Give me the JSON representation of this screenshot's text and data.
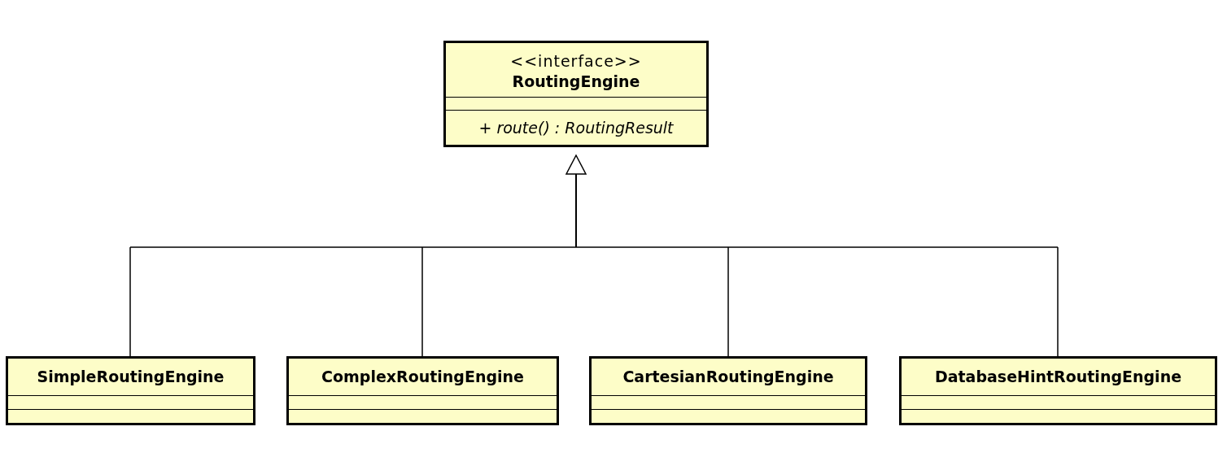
{
  "interface": {
    "stereotype": "<<interface>>",
    "name": "RoutingEngine",
    "operations": [
      "+ route() : RoutingResult"
    ]
  },
  "classes": [
    {
      "name": "SimpleRoutingEngine"
    },
    {
      "name": "ComplexRoutingEngine"
    },
    {
      "name": "CartesianRoutingEngine"
    },
    {
      "name": "DatabaseHintRoutingEngine"
    }
  ]
}
